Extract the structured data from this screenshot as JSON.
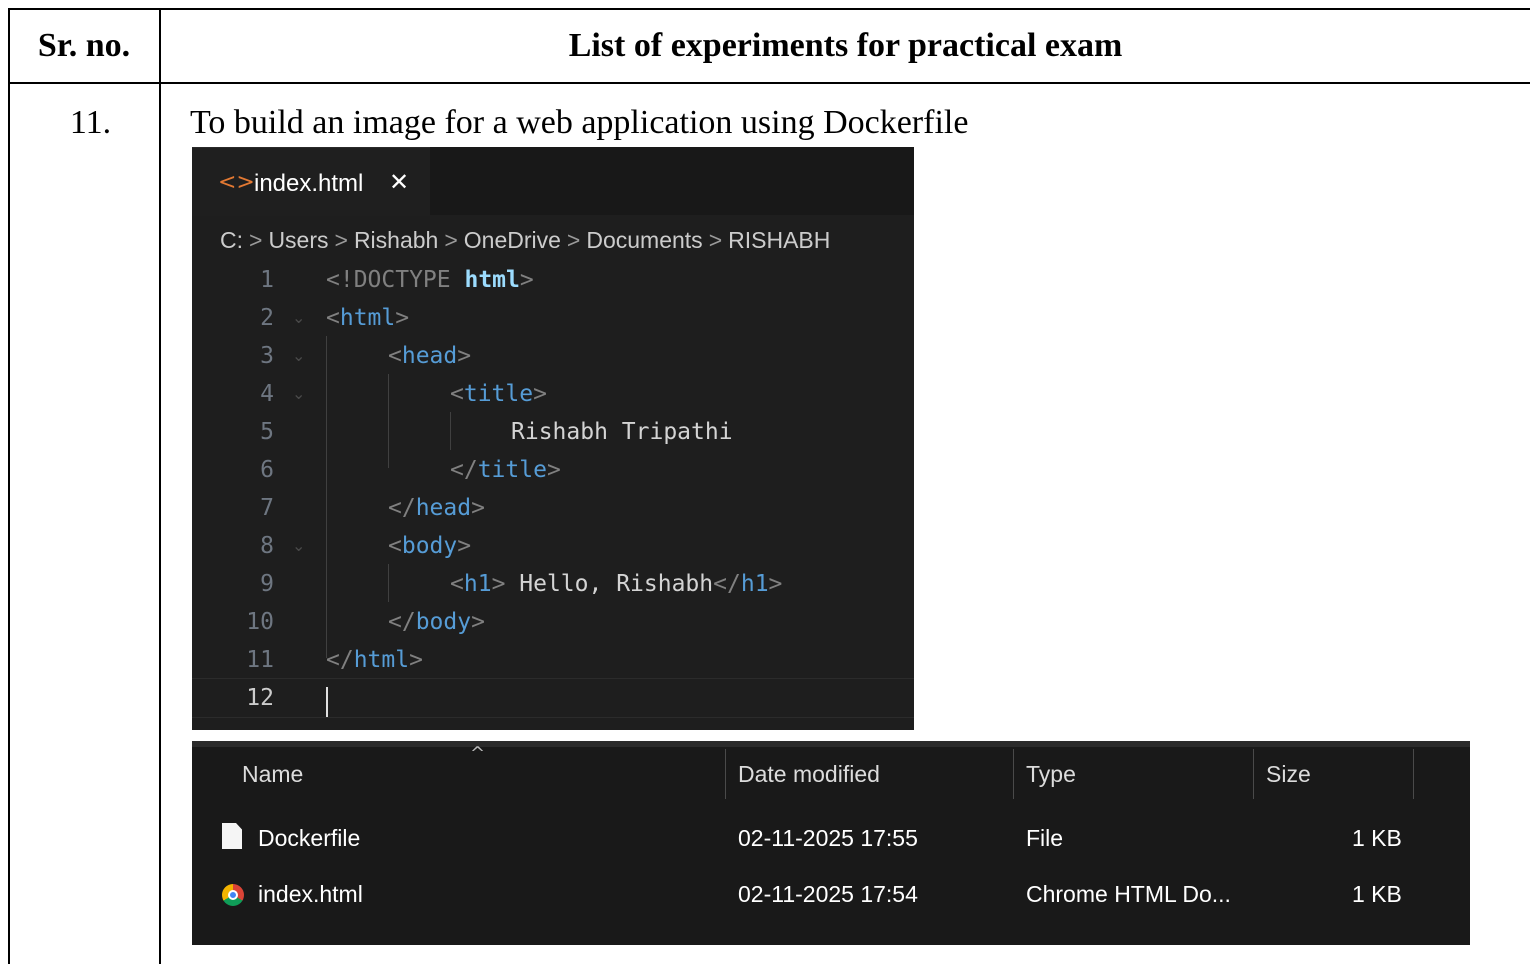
{
  "table": {
    "header": {
      "sr_no": "Sr. no.",
      "list_title": "List of experiments for practical exam"
    },
    "row": {
      "number": "11.",
      "title": "To build an image for a web application using Dockerfile"
    }
  },
  "editor": {
    "tab": {
      "icon": "html-code-icon",
      "label": "index.html",
      "close": "✕"
    },
    "breadcrumb": [
      "C:",
      "Users",
      "Rishabh",
      "OneDrive",
      "Documents",
      "RISHABH"
    ],
    "line_numbers": [
      "1",
      "2",
      "3",
      "4",
      "5",
      "6",
      "7",
      "8",
      "9",
      "10",
      "11",
      "12"
    ],
    "code": {
      "l1": {
        "open": "<!DOCTYPE ",
        "kw": "html",
        "close": ">"
      },
      "l2": {
        "open": "<",
        "tag": "html",
        "close": ">"
      },
      "l3": {
        "open": "<",
        "tag": "head",
        "close": ">"
      },
      "l4": {
        "open": "<",
        "tag": "title",
        "close": ">"
      },
      "l5": {
        "text": "Rishabh Tripathi"
      },
      "l6": {
        "open": "</",
        "tag": "title",
        "close": ">"
      },
      "l7": {
        "open": "</",
        "tag": "head",
        "close": ">"
      },
      "l8": {
        "open": "<",
        "tag": "body",
        "close": ">"
      },
      "l9": {
        "open": "<",
        "tag": "h1",
        "mid": "> ",
        "text": "Hello, Rishabh",
        "open2": "</",
        "tag2": "h1",
        "close": ">"
      },
      "l10": {
        "open": "</",
        "tag": "body",
        "close": ">"
      },
      "l11": {
        "open": "</",
        "tag": "html",
        "close": ">"
      }
    },
    "colors": {
      "background": "#1e1e1e",
      "tag": "#569cd6",
      "text": "#d4d4d4",
      "bracket": "#808080",
      "tab_icon": "#e37933"
    }
  },
  "explorer": {
    "columns": [
      "Name",
      "Date modified",
      "Type",
      "Size"
    ],
    "files": [
      {
        "icon": "file-icon",
        "name": "Dockerfile",
        "date": "02-11-2025 17:55",
        "type": "File",
        "size": "1 KB"
      },
      {
        "icon": "chrome-icon",
        "name": "index.html",
        "date": "02-11-2025 17:54",
        "type": "Chrome HTML Do...",
        "size": "1 KB"
      }
    ]
  }
}
